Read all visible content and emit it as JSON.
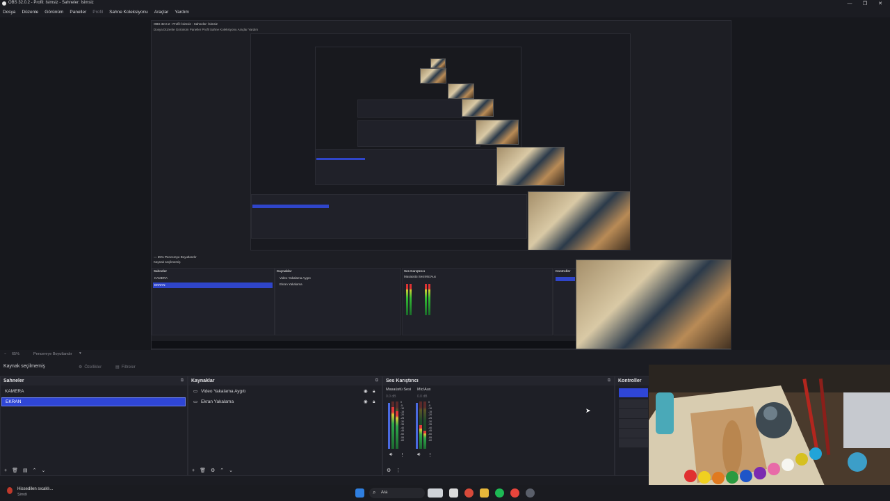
{
  "window": {
    "title": "OBS 32.0.2 - Profil: İsimsiz - Sahneler: İsimsiz",
    "controls": [
      "—",
      "❐",
      "✕"
    ]
  },
  "menu": {
    "items": [
      "Dosya",
      "Düzenle",
      "Görünüm",
      "Paneller",
      "Profil",
      "Sahne Koleksiyonu",
      "Araçlar",
      "Yardım"
    ]
  },
  "status": {
    "zoom": "65%",
    "zoom_mode": "Pencereye Boyutlandır"
  },
  "source_bar": {
    "no_source": "Kaynak seçilmemiş",
    "properties": "Özellikler",
    "filters": "Filtreler"
  },
  "scenes": {
    "title": "Sahneler",
    "items": [
      {
        "label": "KAMERA",
        "selected": false
      },
      {
        "label": "EKRAN",
        "selected": true
      }
    ]
  },
  "sources": {
    "title": "Kaynaklar",
    "items": [
      {
        "label": "Video Yakalama Aygıtı"
      },
      {
        "label": "Ekran Yakalama"
      }
    ]
  },
  "mixer": {
    "title": "Ses Karıştırıcı",
    "channels": [
      {
        "name": "Masaüstü Sesi",
        "db": "0.0 dB"
      },
      {
        "name": "Mic/Aux",
        "db": "0.0 dB"
      }
    ],
    "scale": [
      "0",
      "-5",
      "-10",
      "-15",
      "-20",
      "-25",
      "-30",
      "-35",
      "-40",
      "-45",
      "-50",
      "-55",
      "-60"
    ]
  },
  "controls": {
    "title": "Kontroller"
  },
  "taskbar": {
    "search_placeholder": "Ara",
    "notification_title": "Hissedilen sıcaklı...",
    "notification_sub": "Şimdi"
  },
  "nested": {
    "title": "OBS 32.0.2 - Profil: İsimsiz - Sahneler: İsimsiz",
    "menu": "Dosya  Düzenle  Görünüm  Paneller  Profil  Sahne Koleksiyonu  Araçlar  Yardım",
    "no_source": "Kaynak seçilmemiş",
    "scenes_title": "Sahneler",
    "sources_title": "Kaynaklar",
    "mixer_title": "Ses Karıştırıcı",
    "controls_title": "Kontroller",
    "scene1": "KAMERA",
    "scene2": "EKRAN",
    "src1": "Video Yakalama Aygıtı",
    "src2": "Ekran Yakalama",
    "ch1": "Masaüstü Sesi",
    "ch2": "Mic/Aux"
  },
  "colors": {
    "accent": "#2f46d6",
    "background": "#1b1c22",
    "panel": "#1e1f26"
  }
}
